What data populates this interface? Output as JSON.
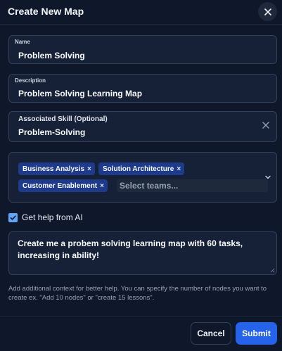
{
  "dialog": {
    "title": "Create New Map",
    "close_icon": "close-icon"
  },
  "name_field": {
    "label": "Name",
    "value": "Problem Solving"
  },
  "description_field": {
    "label": "Description",
    "value": "Problem Solving Learning Map"
  },
  "skill_field": {
    "label": "Associated Skill (Optional)",
    "value": "Problem-Solving",
    "clear_icon": "clear-icon"
  },
  "teams": {
    "chips": [
      {
        "label": "Business Analysis",
        "remove": "×"
      },
      {
        "label": "Solution Architecture",
        "remove": "×"
      },
      {
        "label": "Customer Enablement",
        "remove": "×"
      }
    ],
    "search_placeholder": "Select teams...",
    "dropdown_icon": "chevron-down-icon"
  },
  "ai_help": {
    "checked": true,
    "label": "Get help from AI"
  },
  "context": {
    "value": "Create me a probem solving learning map with 60 tasks, increasing in ability!",
    "help_text": "Add additional context for better help. You can specify the number of nodes you want to create ex. \"Add 10 nodes\" or \"create 15 lessons\"."
  },
  "footer": {
    "cancel_label": "Cancel",
    "submit_label": "Submit"
  },
  "colors": {
    "background": "#0f172a",
    "field_bg": "#162036",
    "border": "#334155",
    "chip_bg": "#1e3a8a",
    "accent": "#2563eb",
    "checkbox": "#60a5fa"
  }
}
